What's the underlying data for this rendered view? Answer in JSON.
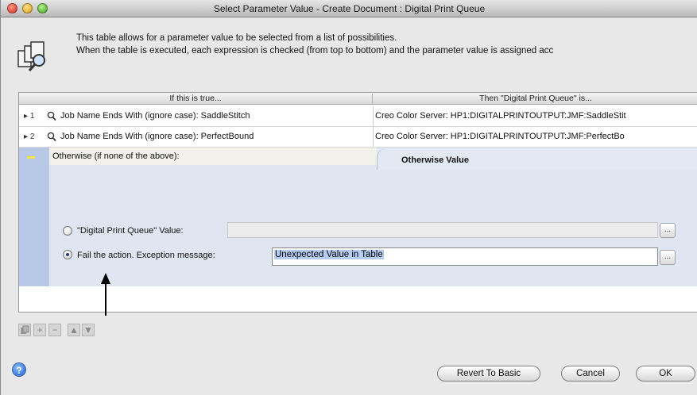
{
  "window": {
    "title": "Select Parameter Value - Create Document : Digital Print Queue"
  },
  "header": {
    "description_line1": "This table allows for a parameter value to be selected from a list of possibilities.",
    "description_line2": "When the table is executed, each expression is checked (from top to bottom) and the parameter value is assigned acc"
  },
  "table": {
    "columns": [
      "If this is true...",
      "Then \"Digital Print Queue\" is..."
    ],
    "rows": [
      {
        "number": "1",
        "condition": "Job Name Ends With (ignore case): SaddleStitch",
        "value": "Creo Color Server: HP1:DIGITALPRINTOUTPUT:JMF:SaddleStit"
      },
      {
        "number": "2",
        "condition": "Job Name Ends With (ignore case): PerfectBound",
        "value": "Creo Color Server: HP1:DIGITALPRINTOUTPUT:JMF:PerfectBo"
      }
    ],
    "otherwise_label": "Otherwise (if none of the above):",
    "otherwise_tab": "Otherwise Value"
  },
  "otherwise": {
    "option_value_label": "\"Digital Print Queue\" Value:",
    "option_fail_label": "Fail the action.  Exception message:",
    "selected_option": "fail",
    "exception_message": "Unexpected Value in Table",
    "ellipsis_label": "..."
  },
  "toolbar": {
    "copy_icon": "copy-icon",
    "add_label": "+",
    "remove_label": "−",
    "move_up_label": "▲",
    "move_down_label": "▼"
  },
  "footer": {
    "help_label": "?",
    "revert_label": "Revert To Basic",
    "cancel_label": "Cancel",
    "ok_label": "OK"
  }
}
